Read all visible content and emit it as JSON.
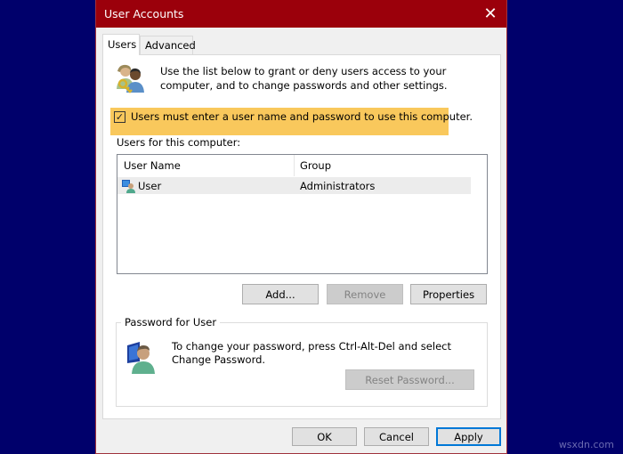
{
  "window": {
    "title": "User Accounts",
    "close_label": "✕"
  },
  "tabs": [
    {
      "label": "Users",
      "active": true
    },
    {
      "label": "Advanced",
      "active": false
    }
  ],
  "users_tab": {
    "intro_text": "Use the list below to grant or deny users access to your computer, and to change passwords and other settings.",
    "require_login": {
      "label": "Users must enter a user name and password to use this computer.",
      "checked": true,
      "check_glyph": "✓",
      "highlight_color": "#f9c85c"
    },
    "users_list_label": "Users for this computer:",
    "columns": [
      "User Name",
      "Group"
    ],
    "rows": [
      {
        "name": "User",
        "group": "Administrators",
        "selected": true
      }
    ],
    "buttons": {
      "add": "Add...",
      "remove": "Remove",
      "properties": "Properties"
    },
    "password_group": {
      "title": "Password for User",
      "text": "To change your password, press Ctrl-Alt-Del and select Change Password.",
      "reset_button": "Reset Password..."
    }
  },
  "footer": {
    "ok": "OK",
    "cancel": "Cancel",
    "apply": "Apply"
  },
  "watermark": "wsxdn.com",
  "colors": {
    "titlebar": "#9b000b",
    "desktop": "#00006b",
    "focus_border": "#0078d7"
  }
}
